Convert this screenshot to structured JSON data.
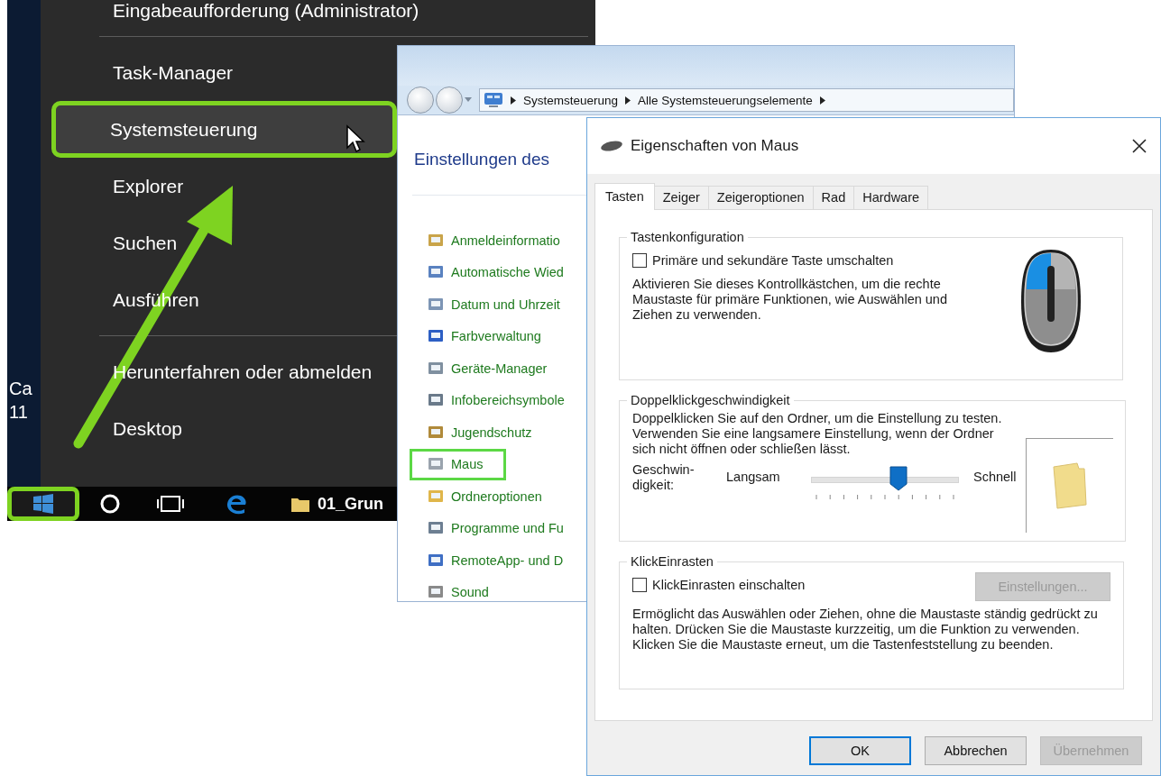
{
  "desktop": {
    "texts": [
      "Ca",
      "11"
    ]
  },
  "start_menu": {
    "sections": [
      [
        {
          "label": "Eingabeaufforderung (Administrator)",
          "selected": false,
          "marked": false
        }
      ],
      [
        {
          "label": "Task-Manager",
          "selected": false,
          "marked": false
        },
        {
          "label": "Systemsteuerung",
          "selected": true,
          "marked": true
        },
        {
          "label": "Explorer",
          "selected": false,
          "marked": false
        },
        {
          "label": "Suchen",
          "selected": false,
          "marked": false
        },
        {
          "label": "Ausführen",
          "selected": false,
          "marked": false
        }
      ],
      [
        {
          "label": "Herunterfahren oder abmelden",
          "selected": false,
          "marked": false
        },
        {
          "label": "Desktop",
          "selected": false,
          "marked": false
        }
      ]
    ]
  },
  "taskbar": {
    "start_button": {
      "marked": true
    },
    "window_label": "01_Grun"
  },
  "control_panel": {
    "breadcrumb": [
      "Systemsteuerung",
      "Alle Systemsteuerungselemente"
    ],
    "heading": "Einstellungen des",
    "items": [
      {
        "label": "Anmeldeinformatio",
        "marked": false
      },
      {
        "label": "Automatische Wied",
        "marked": false
      },
      {
        "label": "Datum und Uhrzeit",
        "marked": false
      },
      {
        "label": "Farbverwaltung",
        "marked": false
      },
      {
        "label": "Geräte-Manager",
        "marked": false
      },
      {
        "label": "Infobereichsymbole",
        "marked": false
      },
      {
        "label": "Jugendschutz",
        "marked": false
      },
      {
        "label": "Maus",
        "marked": true
      },
      {
        "label": "Ordneroptionen",
        "marked": false
      },
      {
        "label": "Programme und Fu",
        "marked": false
      },
      {
        "label": "RemoteApp- und D",
        "marked": false
      },
      {
        "label": "Sound",
        "marked": false
      }
    ]
  },
  "mouse_dialog": {
    "title": "Eigenschaften von Maus",
    "tabs": [
      {
        "label": "Tasten",
        "selected": true
      },
      {
        "label": "Zeiger",
        "selected": false
      },
      {
        "label": "Zeigeroptionen",
        "selected": false
      },
      {
        "label": "Rad",
        "selected": false
      },
      {
        "label": "Hardware",
        "selected": false
      }
    ],
    "button_config": {
      "title": "Tastenkonfiguration",
      "checkbox": {
        "label": "Primäre und sekundäre Taste umschalten",
        "checked": false
      },
      "description": "Aktivieren Sie dieses Kontrollkästchen, um die rechte Maustaste für primäre Funktionen, wie Auswählen und Ziehen zu verwenden."
    },
    "double_click": {
      "title": "Doppelklickgeschwindigkeit",
      "description": "Doppelklicken Sie auf den Ordner, um die Einstellung zu testen. Verwenden Sie eine langsamere Einstellung, wenn der Ordner sich nicht öffnen oder schließen lässt.",
      "speed_label": [
        "Geschwin-",
        "digkeit:"
      ],
      "slow_label": "Langsam",
      "fast_label": "Schnell",
      "speed": {
        "level": 0.59
      }
    },
    "click_lock": {
      "title": "KlickEinrasten",
      "checkbox": {
        "label": "KlickEinrasten einschalten",
        "checked": false
      },
      "settings_button": {
        "label": "Einstellungen...",
        "disabled": true
      },
      "description": "Ermöglicht das Auswählen oder Ziehen, ohne die Maustaste ständig gedrückt zu halten. Drücken Sie die Maustaste kurzzeitig, um die Funktion zu verwenden. Klicken Sie die Maustaste erneut, um die Tastenfeststellung zu beenden."
    },
    "buttons": [
      {
        "label": "OK",
        "default": true,
        "disabled": false
      },
      {
        "label": "Abbrechen",
        "default": false,
        "disabled": false
      },
      {
        "label": "Übernehmen",
        "default": false,
        "disabled": true
      }
    ]
  }
}
